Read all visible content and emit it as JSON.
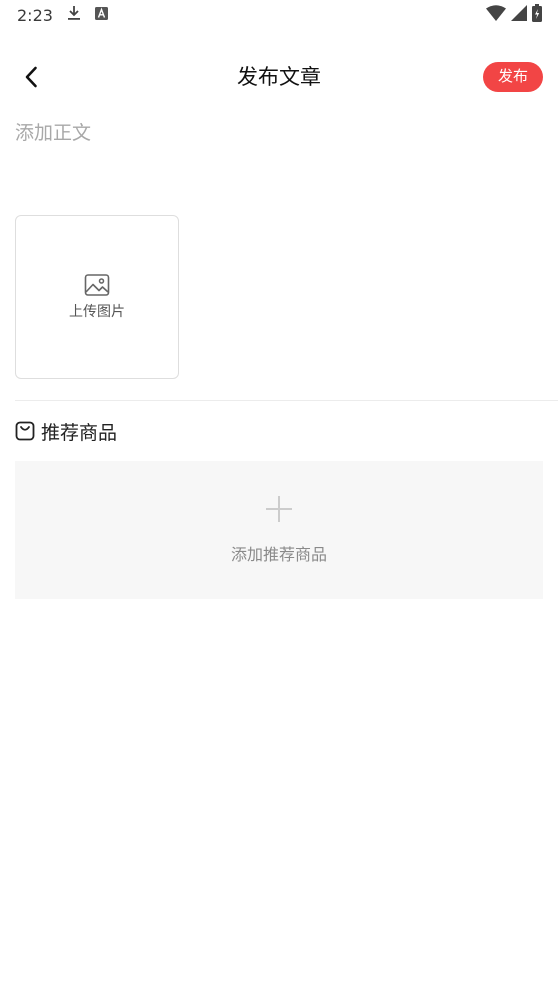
{
  "status_bar": {
    "time": "2:23",
    "icons_left": [
      "download-icon",
      "font-a-icon"
    ],
    "icons_right": [
      "wifi-icon",
      "signal-icon",
      "battery-icon"
    ]
  },
  "header": {
    "title": "发布文章",
    "publish_label": "发布",
    "accent_color": "#f24545"
  },
  "editor": {
    "body_placeholder": "添加正文",
    "body_value": ""
  },
  "upload": {
    "label": "上传图片"
  },
  "recommend": {
    "title": "推荐商品",
    "add_label": "添加推荐商品"
  }
}
